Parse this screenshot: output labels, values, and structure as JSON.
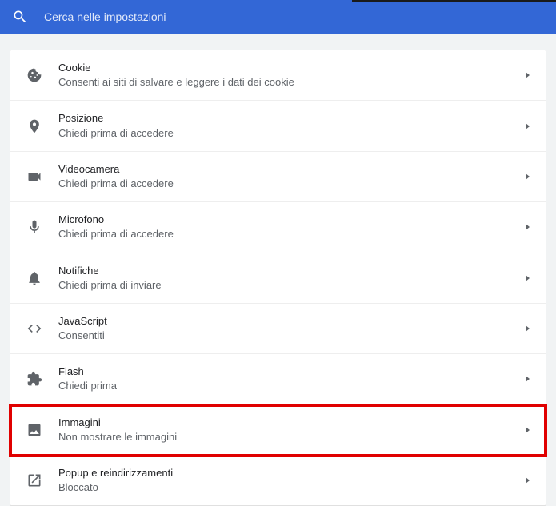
{
  "search": {
    "placeholder": "Cerca nelle impostazioni"
  },
  "rows": [
    {
      "title": "Cookie",
      "subtitle": "Consenti ai siti di salvare e leggere i dati dei cookie"
    },
    {
      "title": "Posizione",
      "subtitle": "Chiedi prima di accedere"
    },
    {
      "title": "Videocamera",
      "subtitle": "Chiedi prima di accedere"
    },
    {
      "title": "Microfono",
      "subtitle": "Chiedi prima di accedere"
    },
    {
      "title": "Notifiche",
      "subtitle": "Chiedi prima di inviare"
    },
    {
      "title": "JavaScript",
      "subtitle": "Consentiti"
    },
    {
      "title": "Flash",
      "subtitle": "Chiedi prima"
    },
    {
      "title": "Immagini",
      "subtitle": "Non mostrare le immagini"
    },
    {
      "title": "Popup e reindirizzamenti",
      "subtitle": "Bloccato"
    }
  ]
}
